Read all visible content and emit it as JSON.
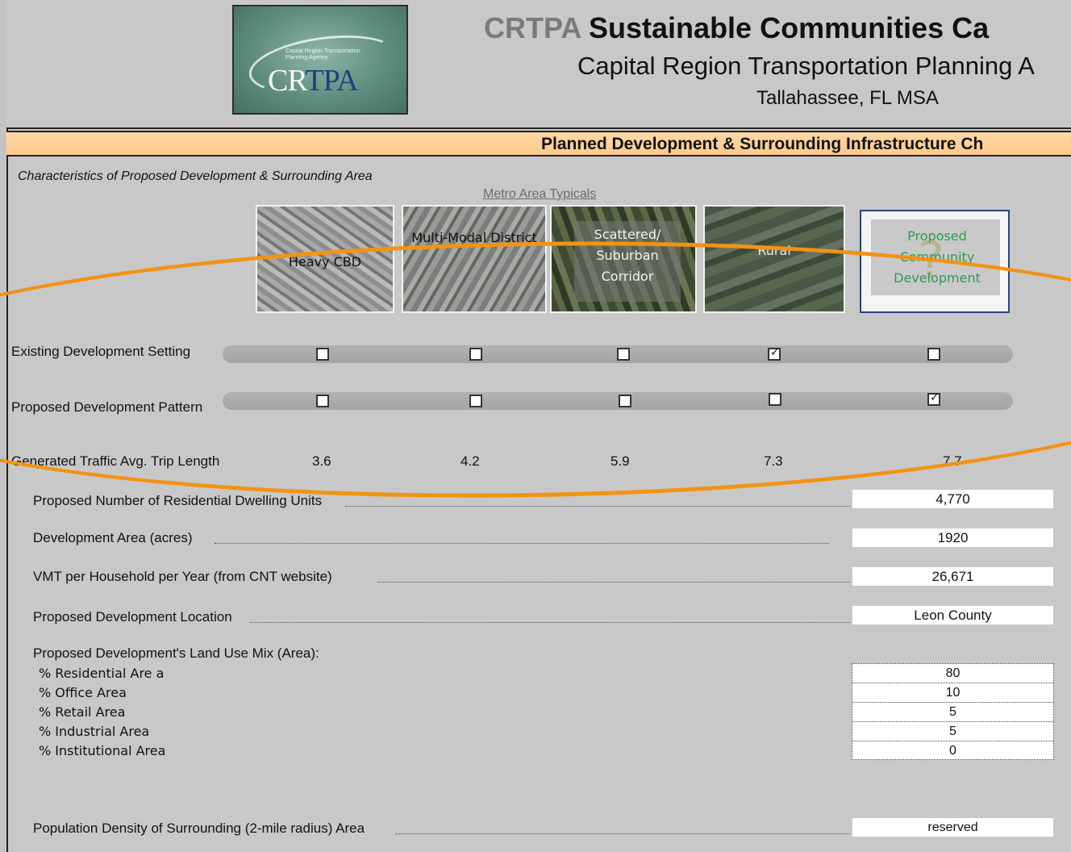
{
  "header": {
    "title_acronym": "CRTPA",
    "title_rest": "Sustainable Communities Ca",
    "subtitle": "Capital Region Transportation Planning A",
    "location": "Tallahassee, FL MSA",
    "logo": {
      "small_text": "Capital Region Transportation Planning Agency",
      "mark_prefix": "CR",
      "mark_accent": "TPA"
    }
  },
  "section_band": "Planned Development & Surrounding Infrastructure Ch",
  "section_label": "Characteristics of Proposed Development & Surrounding Area",
  "metro_label": "Metro Area Typicals",
  "tiles": [
    {
      "label": "Heavy CBD"
    },
    {
      "label": "Multi-Modal District"
    },
    {
      "label": "Scattered/ Suburban Corridor"
    },
    {
      "label": "Rural"
    },
    {
      "label": "Proposed Community Development"
    }
  ],
  "rows": {
    "existing_setting": {
      "label": "Existing Development Setting",
      "checked": [
        false,
        false,
        false,
        true,
        false
      ]
    },
    "proposed_pattern": {
      "label": "Proposed Development Pattern",
      "checked": [
        false,
        false,
        false,
        false,
        true
      ]
    },
    "trip_length": {
      "label": "Generated Traffic Avg. Trip Length",
      "values": [
        "3.6",
        "4.2",
        "5.9",
        "7.3",
        "7.7"
      ]
    }
  },
  "form": {
    "dwelling_units": {
      "label": "Proposed Number of Residential Dwelling Units",
      "value": "4,770"
    },
    "area": {
      "label": "Development Area (acres)",
      "value": "1920"
    },
    "vmt": {
      "label": "VMT per Household per Year (from CNT website)",
      "value": "26,671"
    },
    "location": {
      "label": "Proposed Development Location",
      "value": "Leon County"
    },
    "population": {
      "label": "Population Density of Surrounding (2-mile radius) Area",
      "value": "reserved"
    }
  },
  "land_use": {
    "title": "Proposed Development's Land Use Mix (Area):",
    "items": [
      {
        "label": "% Residential Are a",
        "value": "80"
      },
      {
        "label": "% Office Area",
        "value": "10"
      },
      {
        "label": "% Retail Area",
        "value": "5"
      },
      {
        "label": "% Industrial Area",
        "value": "5"
      },
      {
        "label": "% Institutional Area",
        "value": "0"
      }
    ]
  },
  "colors": {
    "band": "#ffc98a",
    "ring": "#f39312",
    "proposed_text": "#2e9b55",
    "frame_blue": "#25477f"
  }
}
